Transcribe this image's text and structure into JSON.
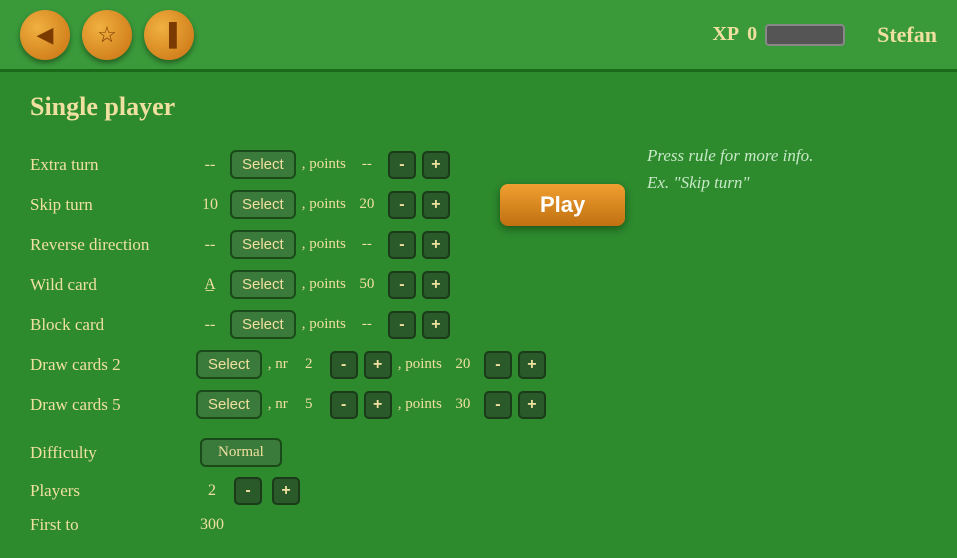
{
  "header": {
    "icons": [
      {
        "name": "back-icon",
        "symbol": "◀"
      },
      {
        "name": "medal-icon",
        "symbol": "★"
      },
      {
        "name": "chart-icon",
        "symbol": "▐"
      }
    ],
    "xp_label": "XP",
    "xp_value": "0",
    "username": "Stefan"
  },
  "page": {
    "title": "Single player",
    "play_button": "Play"
  },
  "info": {
    "line1": "Press rule for more info.",
    "line2": "Ex. \"Skip turn\""
  },
  "rules": [
    {
      "label": "Extra turn",
      "value": "--",
      "select_label": "Select",
      "points_label": ", points",
      "points_value": "--"
    },
    {
      "label": "Skip turn",
      "value": "10",
      "select_label": "Select",
      "points_label": ", points",
      "points_value": "20"
    },
    {
      "label": "Reverse direction",
      "value": "--",
      "select_label": "Select",
      "points_label": ", points",
      "points_value": "--"
    },
    {
      "label": "Wild card",
      "value": "A̲",
      "select_label": "Select",
      "points_label": ", points",
      "points_value": "50"
    },
    {
      "label": "Block card",
      "value": "--",
      "select_label": "Select",
      "points_label": ", points",
      "points_value": "--"
    }
  ],
  "draw_rules": [
    {
      "label": "Draw cards 2",
      "select_label": "Select",
      "nr_label": ", nr",
      "nr_value": "2",
      "points_label": ", points",
      "points_value": "20"
    },
    {
      "label": "Draw cards 5",
      "select_label": "Select",
      "nr_label": ", nr",
      "nr_value": "5",
      "points_label": ", points",
      "points_value": "30"
    }
  ],
  "difficulty": {
    "label": "Difficulty",
    "value": "Normal"
  },
  "players": {
    "label": "Players",
    "value": "2"
  },
  "first_to": {
    "label": "First to",
    "value": "300"
  },
  "buttons": {
    "minus": "-",
    "plus": "+"
  }
}
